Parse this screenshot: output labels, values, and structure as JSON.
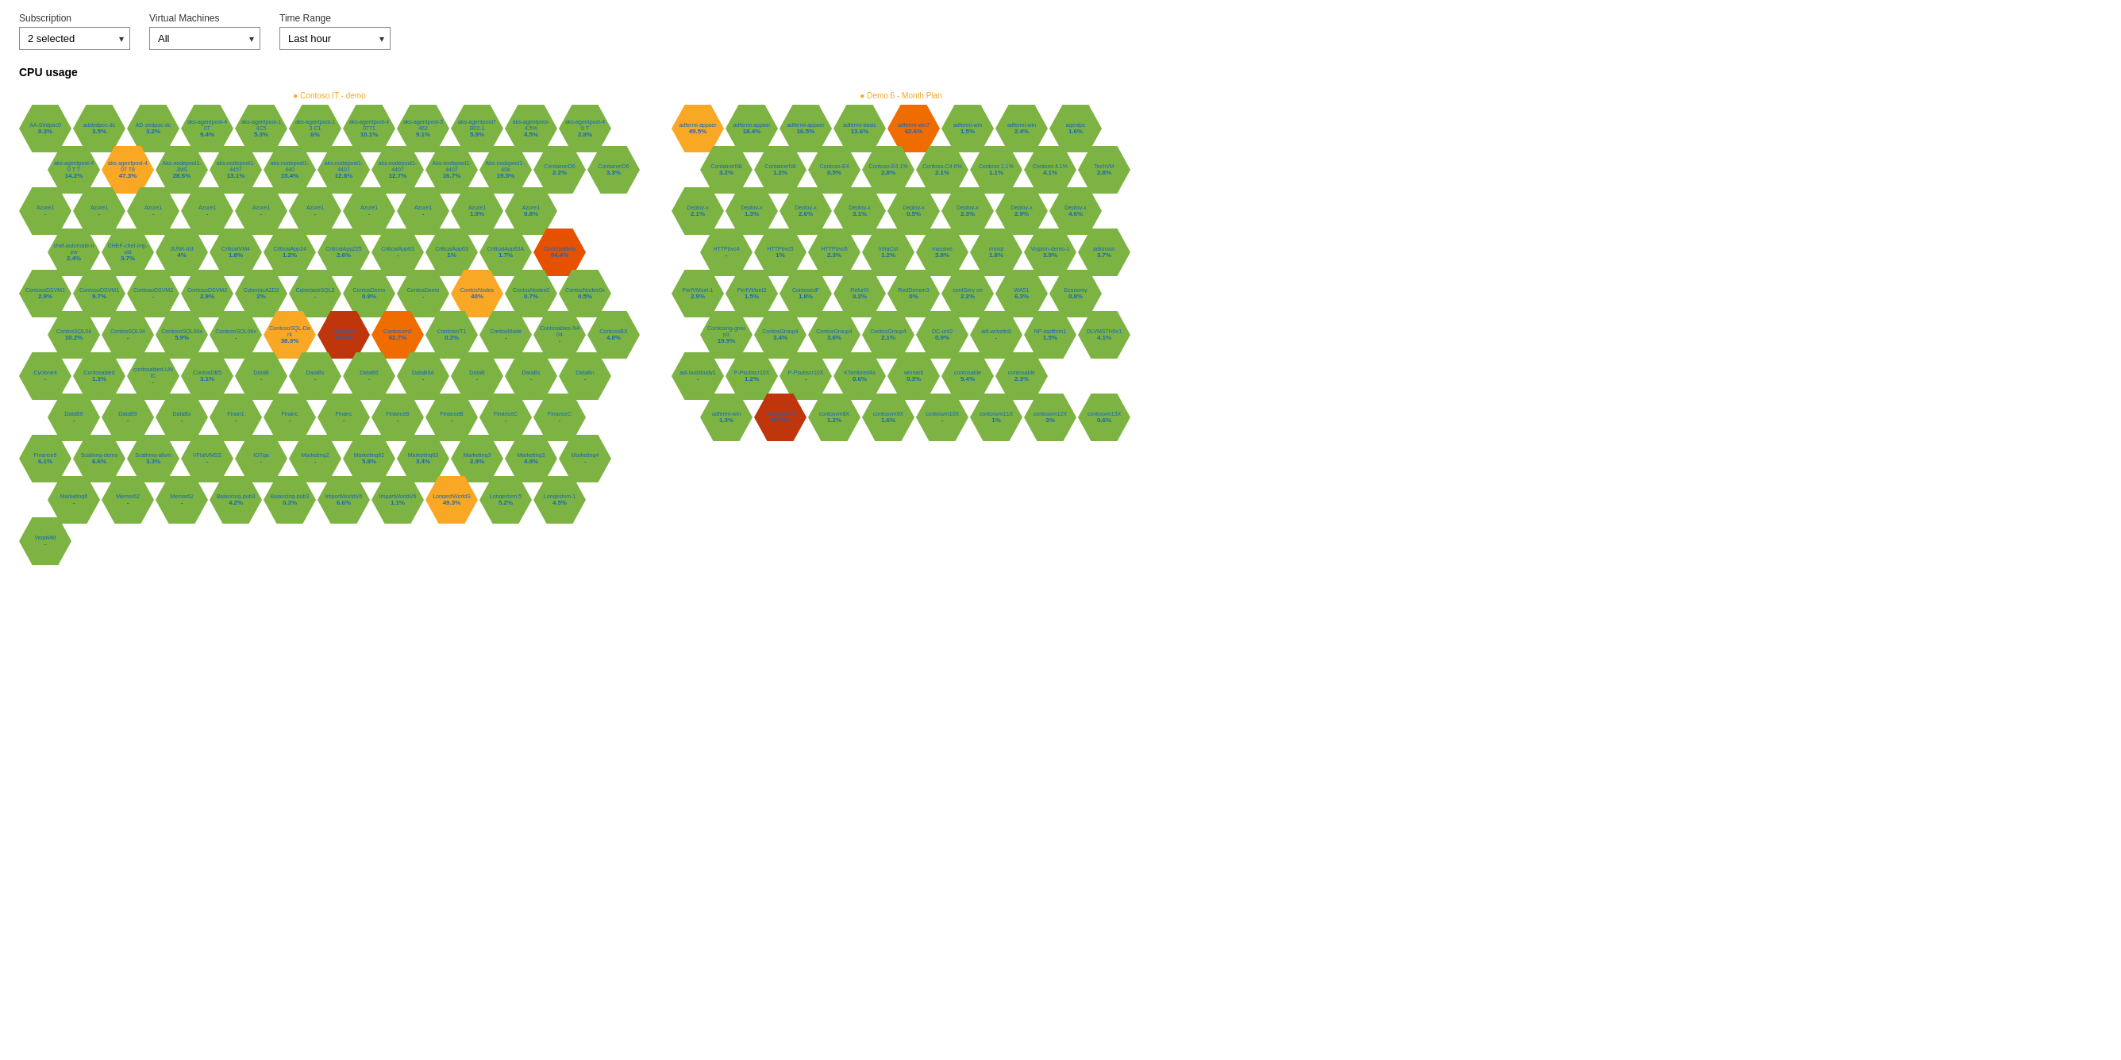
{
  "filters": {
    "subscription_label": "Subscription",
    "subscription_value": "2 selected",
    "vm_label": "Virtual Machines",
    "vm_value": "All",
    "timerange_label": "Time Range",
    "timerange_value": "Last hour"
  },
  "section": {
    "title": "CPU usage"
  },
  "chart1": {
    "subscription_name": "Contoso IT - demo",
    "rows": [
      [
        {
          "name": "AA-Strdpoc0",
          "val": "0.3%",
          "color": "green"
        },
        {
          "name": "adstrdpoc-dc",
          "val": "3.5%",
          "color": "green"
        },
        {
          "name": "AD-strdpoc-dc",
          "val": "3.2%",
          "color": "green"
        },
        {
          "name": "aks-agentpool-40T",
          "val": "9.4%",
          "color": "green"
        },
        {
          "name": "aks-agentpool-14C5",
          "val": "5.3%",
          "color": "green"
        },
        {
          "name": "aks-agentpool-13 C1",
          "val": "6%",
          "color": "green"
        },
        {
          "name": "aks-agentpool-40771",
          "val": "10.1%",
          "color": "green"
        },
        {
          "name": "aks-agentpool-3462",
          "val": "9.1%",
          "color": "green"
        },
        {
          "name": "aks-agentpool7B02-1",
          "val": "5.9%",
          "color": "green"
        },
        {
          "name": "aks-agentpool-4.5%",
          "val": "4.5%",
          "color": "green"
        },
        {
          "name": "aks-agentpool-40 T",
          "val": "2.8%",
          "color": "green"
        }
      ],
      [
        {
          "name": "aks-agentpool-40 T T",
          "val": "14.2%",
          "color": "green"
        },
        {
          "name": "aks agentpool-407 T8",
          "val": "47.3%",
          "color": "yellow"
        },
        {
          "name": "Aks-nodepool1-JMS",
          "val": "28.6%",
          "color": "green"
        },
        {
          "name": "aks-nodepool1-4457",
          "val": "13.1%",
          "color": "green"
        },
        {
          "name": "aks-nodepool1-440",
          "val": "15.4%",
          "color": "green"
        },
        {
          "name": "aks-nodepool1-4407",
          "val": "12.8%",
          "color": "green"
        },
        {
          "name": "aks-nodepool1-4407",
          "val": "12.7%",
          "color": "green"
        },
        {
          "name": "Aks-nodepool1-4407",
          "val": "16.7%",
          "color": "green"
        },
        {
          "name": "Aks-nodepool1 -40k",
          "val": "19.5%",
          "color": "green"
        },
        {
          "name": "ContainerD6",
          "val": "2.2%",
          "color": "green"
        },
        {
          "name": "ContainerD6",
          "val": "3.3%",
          "color": "green"
        }
      ],
      [
        {
          "name": "Azure1",
          "val": "-",
          "color": "green"
        },
        {
          "name": "Azure1",
          "val": "-",
          "color": "green"
        },
        {
          "name": "Azure1",
          "val": "-",
          "color": "green"
        },
        {
          "name": "Azure1",
          "val": "-",
          "color": "green"
        },
        {
          "name": "Azure1",
          "val": "-",
          "color": "green"
        },
        {
          "name": "Azure1",
          "val": "-",
          "color": "green"
        },
        {
          "name": "Azure1",
          "val": "-",
          "color": "green"
        },
        {
          "name": "Azure1",
          "val": "-",
          "color": "green"
        },
        {
          "name": "Azure1",
          "val": "1.9%",
          "color": "green"
        },
        {
          "name": "Azure1",
          "val": "0.8%",
          "color": "green"
        }
      ],
      [
        {
          "name": "chef-automate-new",
          "val": "2.4%",
          "color": "green"
        },
        {
          "name": "CHEF-chef-imp-old",
          "val": "3.7%",
          "color": "green"
        },
        {
          "name": "JUNK-list",
          "val": "4%",
          "color": "green"
        },
        {
          "name": "CriticalVM4",
          "val": "1.8%",
          "color": "green"
        },
        {
          "name": "CriticalApp24",
          "val": "1.2%",
          "color": "green"
        },
        {
          "name": "CriticalApp225",
          "val": "2.6%",
          "color": "green"
        },
        {
          "name": "CriticalApp63",
          "val": "-",
          "color": "green"
        },
        {
          "name": "CriticalApp63",
          "val": "1%",
          "color": "green"
        },
        {
          "name": "CriticalApp63A",
          "val": "1.7%",
          "color": "green"
        },
        {
          "name": "ContosoBeta",
          "val": "94.4%",
          "color": "orange"
        }
      ],
      [
        {
          "name": "ContosoDSVM1",
          "val": "2.9%",
          "color": "green"
        },
        {
          "name": "ContosoDSVM1",
          "val": "9.7%",
          "color": "green"
        },
        {
          "name": "ContosoDSVM2",
          "val": "-",
          "color": "green"
        },
        {
          "name": "ContosoDSVM2",
          "val": "2.9%",
          "color": "green"
        },
        {
          "name": "CyberjacA2D2",
          "val": "2%",
          "color": "green"
        },
        {
          "name": "CyberjackSQL3",
          "val": "-",
          "color": "green"
        },
        {
          "name": "ContosDemo",
          "val": "0.9%",
          "color": "green"
        },
        {
          "name": "ContosDemo",
          "val": "-",
          "color": "green"
        },
        {
          "name": "ContosNodes",
          "val": "40%",
          "color": "yellow"
        },
        {
          "name": "ContosNodes0",
          "val": "0.7%",
          "color": "green"
        },
        {
          "name": "ContosNodes0x",
          "val": "0.5%",
          "color": "green"
        }
      ],
      [
        {
          "name": "ContosSQL04",
          "val": "10.2%",
          "color": "green"
        },
        {
          "name": "ContosSQL04",
          "val": "-",
          "color": "green"
        },
        {
          "name": "ContosoSQL04x",
          "val": "5.9%",
          "color": "green"
        },
        {
          "name": "ContosoSQL06x",
          "val": "-",
          "color": "green"
        },
        {
          "name": "ContosoSQL-Dark",
          "val": "38.3%",
          "color": "yellow"
        },
        {
          "name": "Contosur4",
          "val": "96.6%",
          "color": "dark-orange"
        },
        {
          "name": "Contosum2",
          "val": "62.7%",
          "color": "light-orange"
        },
        {
          "name": "ContosoIT1",
          "val": "0.2%",
          "color": "green"
        },
        {
          "name": "ContosMode",
          "val": "-",
          "color": "green"
        },
        {
          "name": "Contosables-N404",
          "val": "-",
          "color": "green"
        },
        {
          "name": "ContosoBX",
          "val": "4.8%",
          "color": "green"
        }
      ],
      [
        {
          "name": "Cyclone4",
          "val": "-",
          "color": "green"
        },
        {
          "name": "Contosabled",
          "val": "1.3%",
          "color": "green"
        },
        {
          "name": "contosabled-UNIC",
          "val": "-",
          "color": "green"
        },
        {
          "name": "ContosDB5",
          "val": "3.1%",
          "color": "green"
        },
        {
          "name": "DataB",
          "val": "-",
          "color": "green"
        },
        {
          "name": "DataBs",
          "val": "-",
          "color": "green"
        },
        {
          "name": "DataB6",
          "val": "-",
          "color": "green"
        },
        {
          "name": "DataB6A",
          "val": "-",
          "color": "green"
        },
        {
          "name": "DataB",
          "val": "-",
          "color": "green"
        },
        {
          "name": "DataBs",
          "val": "-",
          "color": "green"
        },
        {
          "name": "DataBn",
          "val": "-",
          "color": "green"
        }
      ],
      [
        {
          "name": "DataB8",
          "val": "-",
          "color": "green"
        },
        {
          "name": "DataB9",
          "val": "-",
          "color": "green"
        },
        {
          "name": "DataBx",
          "val": "-",
          "color": "green"
        },
        {
          "name": "Finan1",
          "val": "-",
          "color": "green"
        },
        {
          "name": "Financ",
          "val": "-",
          "color": "green"
        },
        {
          "name": "Financ",
          "val": "-",
          "color": "green"
        },
        {
          "name": "FinanceB",
          "val": "-",
          "color": "green"
        },
        {
          "name": "FinanceB",
          "val": "-",
          "color": "green"
        },
        {
          "name": "FinanceC",
          "val": "-",
          "color": "green"
        },
        {
          "name": "FinanceC",
          "val": "-",
          "color": "green"
        }
      ],
      [
        {
          "name": "Finance6",
          "val": "6.1%",
          "color": "green"
        },
        {
          "name": "Scalinng-demo",
          "val": "6.6%",
          "color": "green"
        },
        {
          "name": "Scalinng-allvm",
          "val": "3.3%",
          "color": "green"
        },
        {
          "name": "VFlatVMSS",
          "val": "-",
          "color": "green"
        },
        {
          "name": "IOTga",
          "val": "-",
          "color": "green"
        },
        {
          "name": "Marketing2",
          "val": "-",
          "color": "green"
        },
        {
          "name": "Marketing62",
          "val": "5.8%",
          "color": "green"
        },
        {
          "name": "Marketing63",
          "val": "3.4%",
          "color": "green"
        },
        {
          "name": "Marketing3",
          "val": "2.9%",
          "color": "green"
        },
        {
          "name": "Marketing3",
          "val": "4.9%",
          "color": "green"
        },
        {
          "name": "Marketing4",
          "val": "-",
          "color": "green"
        }
      ],
      [
        {
          "name": "Marketing6",
          "val": "-",
          "color": "green"
        },
        {
          "name": "Memor62",
          "val": "-",
          "color": "green"
        },
        {
          "name": "Memor62",
          "val": "-",
          "color": "green"
        },
        {
          "name": "Balancing-pub3",
          "val": "4.2%",
          "color": "green"
        },
        {
          "name": "Balancing-pub3",
          "val": "0.3%",
          "color": "green"
        },
        {
          "name": "ImportWorldV6",
          "val": "6.6%",
          "color": "green"
        },
        {
          "name": "ImportWorldV6",
          "val": "1.1%",
          "color": "green"
        },
        {
          "name": "LongestWorldS",
          "val": "49.3%",
          "color": "yellow"
        },
        {
          "name": "Longestvm-5",
          "val": "5.2%",
          "color": "green"
        },
        {
          "name": "Longestvm-1",
          "val": "4.5%",
          "color": "green"
        }
      ],
      [
        {
          "name": "VegaMkt",
          "val": "-",
          "color": "green"
        }
      ]
    ]
  },
  "chart2": {
    "subscription_name": "Demo 6 - Month Plan",
    "rows": [
      [
        {
          "name": "adfermi-appser",
          "val": "49.5%",
          "color": "yellow"
        },
        {
          "name": "adfermi-appser",
          "val": "18.4%",
          "color": "green"
        },
        {
          "name": "adfermi-appser",
          "val": "16.5%",
          "color": "green"
        },
        {
          "name": "adfermi-basic",
          "val": "13.6%",
          "color": "green"
        },
        {
          "name": "adfermi-win7",
          "val": "62.6%",
          "color": "light-orange"
        },
        {
          "name": "adfermi-win",
          "val": "1.5%",
          "color": "green"
        },
        {
          "name": "adfermi-win",
          "val": "2.4%",
          "color": "green"
        },
        {
          "name": "agentpc",
          "val": "1.6%",
          "color": "green"
        }
      ],
      [
        {
          "name": "ContainerN8",
          "val": "3.2%",
          "color": "green"
        },
        {
          "name": "ContainerN8",
          "val": "1.2%",
          "color": "green"
        },
        {
          "name": "Contoso-E4",
          "val": "0.5%",
          "color": "green"
        },
        {
          "name": "Contoso-E4 1%",
          "val": "2.8%",
          "color": "green"
        },
        {
          "name": "Contoso-C4 6%",
          "val": "2.1%",
          "color": "green"
        },
        {
          "name": "Contoso 1.1%",
          "val": "1.1%",
          "color": "green"
        },
        {
          "name": "Contoso 4.1%",
          "val": "4.1%",
          "color": "green"
        },
        {
          "name": "TechVM",
          "val": "2.8%",
          "color": "green"
        }
      ],
      [
        {
          "name": "Deploy-x",
          "val": "2.1%",
          "color": "green"
        },
        {
          "name": "Deploy-x",
          "val": "1.3%",
          "color": "green"
        },
        {
          "name": "Deploy-x",
          "val": "2.6%",
          "color": "green"
        },
        {
          "name": "Deploy-x",
          "val": "3.1%",
          "color": "green"
        },
        {
          "name": "Deploy-x",
          "val": "0.5%",
          "color": "green"
        },
        {
          "name": "Deploy-x",
          "val": "2.3%",
          "color": "green"
        },
        {
          "name": "Deploy-x",
          "val": "2.9%",
          "color": "green"
        },
        {
          "name": "Deploy-x",
          "val": "4.6%",
          "color": "green"
        }
      ],
      [
        {
          "name": "HTTPbvc4",
          "val": "-",
          "color": "green"
        },
        {
          "name": "HTTPbvc5",
          "val": "1%",
          "color": "green"
        },
        {
          "name": "HTTPbvc6",
          "val": "2.3%",
          "color": "green"
        },
        {
          "name": "InfraCst",
          "val": "1.2%",
          "color": "green"
        },
        {
          "name": "massive",
          "val": "3.8%",
          "color": "green"
        },
        {
          "name": "mysql",
          "val": "1.8%",
          "color": "green"
        },
        {
          "name": "Vispion-demo-1",
          "val": "3.9%",
          "color": "green"
        },
        {
          "name": "jatkinson",
          "val": "3.7%",
          "color": "green"
        }
      ],
      [
        {
          "name": "PerfVMset-1",
          "val": "2.9%",
          "color": "green"
        },
        {
          "name": "PerfVMset2",
          "val": "1.5%",
          "color": "green"
        },
        {
          "name": "ContosedF",
          "val": "1.8%",
          "color": "green"
        },
        {
          "name": "RefurlX",
          "val": "0.2%",
          "color": "green"
        },
        {
          "name": "RedDemon3",
          "val": "0%",
          "color": "green"
        },
        {
          "name": "contSery on",
          "val": "2.2%",
          "color": "green"
        },
        {
          "name": "WA51",
          "val": "6.3%",
          "color": "green"
        },
        {
          "name": "Economy",
          "val": "0.8%",
          "color": "green"
        }
      ],
      [
        {
          "name": "Contosing-group3",
          "val": "19.9%",
          "color": "green"
        },
        {
          "name": "ContosGroup4",
          "val": "3.4%",
          "color": "green"
        },
        {
          "name": "ContosGroup4",
          "val": "3.8%",
          "color": "green"
        },
        {
          "name": "ContosGroup4",
          "val": "2.1%",
          "color": "green"
        },
        {
          "name": "DC-unt2",
          "val": "0.9%",
          "color": "green"
        },
        {
          "name": "adl-wrksttn8",
          "val": "-",
          "color": "green"
        },
        {
          "name": "NP-sqdthim1",
          "val": "1.5%",
          "color": "green"
        },
        {
          "name": "DLVMSTH9x1",
          "val": "4.1%",
          "color": "green"
        }
      ],
      [
        {
          "name": "adl-buildbudy1",
          "val": "-",
          "color": "green"
        },
        {
          "name": "P-Psubscr10X",
          "val": "1.2%",
          "color": "green"
        },
        {
          "name": "P-Psubscr10X",
          "val": "-",
          "color": "green"
        },
        {
          "name": "KTambred4a",
          "val": "0.6%",
          "color": "green"
        },
        {
          "name": "winnant",
          "val": "0.3%",
          "color": "green"
        },
        {
          "name": "contosable",
          "val": "9.4%",
          "color": "green"
        },
        {
          "name": "contosable",
          "val": "2.3%",
          "color": "green"
        }
      ],
      [
        {
          "name": "adfermi-win",
          "val": "1.3%",
          "color": "green"
        },
        {
          "name": "contosvm6X",
          "val": "95.2%",
          "color": "dark-orange"
        },
        {
          "name": "contosvm8X",
          "val": "1.2%",
          "color": "green"
        },
        {
          "name": "contosvm9X",
          "val": "1.6%",
          "color": "green"
        },
        {
          "name": "contosvm10X",
          "val": "-",
          "color": "green"
        },
        {
          "name": "contosvm11X",
          "val": "1%",
          "color": "green"
        },
        {
          "name": "contosvm12X",
          "val": "3%",
          "color": "green"
        },
        {
          "name": "contosvm13X",
          "val": "0.6%",
          "color": "green"
        }
      ]
    ]
  }
}
